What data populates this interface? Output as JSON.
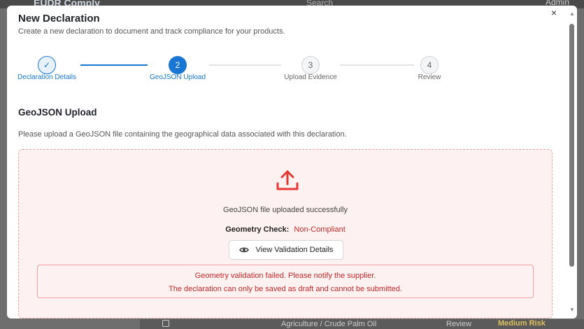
{
  "background": {
    "brand": "EUDR Comply",
    "search_placeholder": "Search",
    "user": "Admin",
    "row": {
      "commodity": "Agriculture / Crude Palm Oil",
      "status": "Review",
      "risk": "Medium Risk"
    }
  },
  "modal": {
    "title": "New Declaration",
    "subtitle": "Create a new declaration to document and track compliance for your products.",
    "close_glyph": "×"
  },
  "stepper": {
    "steps": [
      {
        "number": "✓",
        "label": "Declaration Details",
        "state": "done"
      },
      {
        "number": "2",
        "label": "GeoJSON Upload",
        "state": "active"
      },
      {
        "number": "3",
        "label": "Upload Evidence",
        "state": "pending"
      },
      {
        "number": "4",
        "label": "Review",
        "state": "pending"
      }
    ]
  },
  "section": {
    "title": "GeoJSON Upload",
    "description": "Please upload a GeoJSON file containing the geographical data associated with this declaration."
  },
  "upload": {
    "icon": "upload-icon",
    "status_text": "GeoJSON file uploaded successfully",
    "geometry_check_label": "Geometry Check:",
    "geometry_check_value": "Non-Compliant",
    "view_button_label": "View Validation Details",
    "view_button_icon": "eye-icon"
  },
  "error": {
    "line1": "Geometry validation failed. Please notify the supplier.",
    "line2": "The declaration can only be saved as draft and cannot be submitted."
  },
  "colors": {
    "primary": "#1976d2",
    "error": "#c62828",
    "upload_bg": "#fdf1f1",
    "upload_border": "#e8a3a3"
  }
}
